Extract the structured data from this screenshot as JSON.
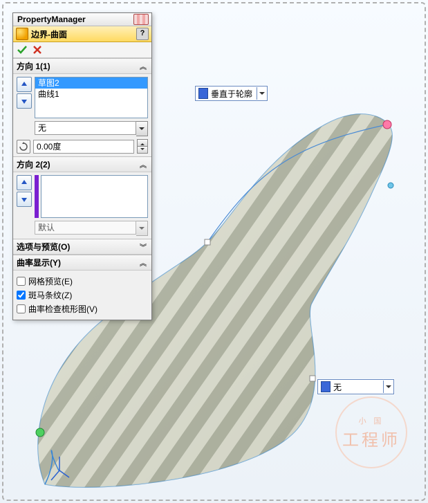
{
  "pm_title": "PropertyManager",
  "feature_title": "边界-曲面",
  "help": "?",
  "sections": {
    "dir1": {
      "title": "方向 1(1)",
      "list": [
        "草图2",
        "曲线1"
      ],
      "type_option": "无",
      "angle": "0.00度"
    },
    "dir2": {
      "title": "方向 2(2)",
      "type_option": "默认"
    },
    "options": {
      "title": "选项与预览(O)"
    },
    "curv": {
      "title": "曲率显示(Y)",
      "mesh_preview": "网格预览(E)",
      "zebra": "斑马条纹(Z)",
      "comb": "曲率检查梳形图(V)",
      "states": {
        "mesh": false,
        "zebra": true,
        "comb": false
      }
    }
  },
  "callouts": {
    "c1": "垂直于轮廓",
    "c2": "无"
  },
  "watermark": {
    "top_small": "小 国",
    "main": "工程师"
  }
}
